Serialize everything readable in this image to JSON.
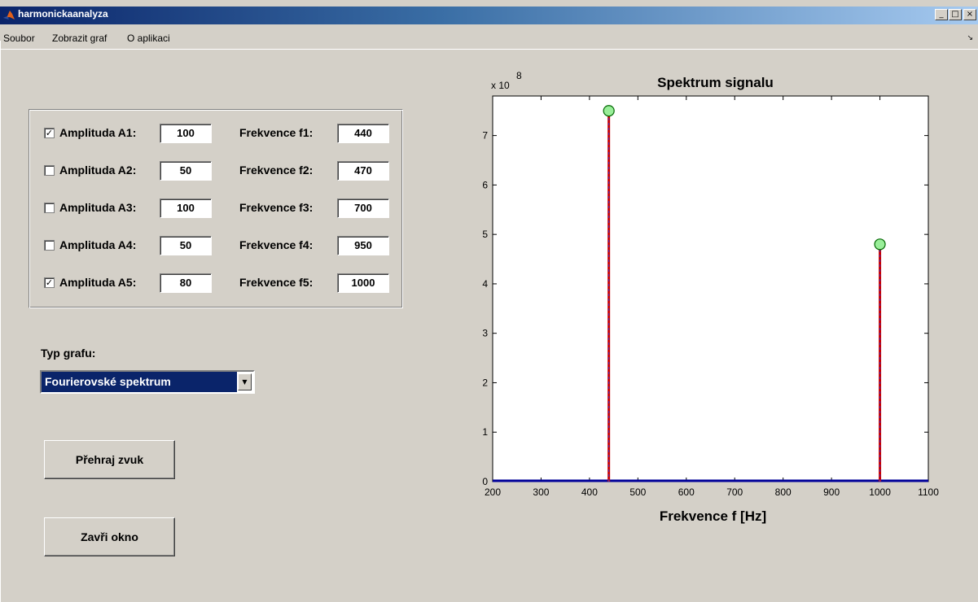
{
  "window": {
    "title": "harmonickaanalyza",
    "buttons": [
      "_",
      "□",
      "×"
    ]
  },
  "menu": {
    "items": [
      "Soubor",
      "Zobrazit graf",
      "O aplikaci"
    ],
    "arrow": "↘"
  },
  "params": {
    "rows": [
      {
        "checked": true,
        "amp_label": "Amplituda A1:",
        "amp": "100",
        "freq_label": "Frekvence f1:",
        "freq": "440"
      },
      {
        "checked": false,
        "amp_label": "Amplituda A2:",
        "amp": "50",
        "freq_label": "Frekvence f2:",
        "freq": "470"
      },
      {
        "checked": false,
        "amp_label": "Amplituda A3:",
        "amp": "100",
        "freq_label": "Frekvence f3:",
        "freq": "700"
      },
      {
        "checked": false,
        "amp_label": "Amplituda A4:",
        "amp": "50",
        "freq_label": "Frekvence f4:",
        "freq": "950"
      },
      {
        "checked": true,
        "amp_label": "Amplituda A5:",
        "amp": "80",
        "freq_label": "Frekvence f5:",
        "freq": "1000"
      }
    ]
  },
  "graph_type": {
    "label": "Typ grafu:",
    "selected": "Fourierovské spektrum"
  },
  "buttons": {
    "play": "Přehraj zvuk",
    "close": "Zavři okno"
  },
  "chart_data": {
    "type": "stem",
    "title": "Spektrum signalu",
    "xlabel": "Frekvence f [Hz]",
    "ylabel": "",
    "scale_label": "x 10",
    "scale_exponent": "8",
    "xlim": [
      200,
      1100
    ],
    "ylim": [
      0,
      7.8
    ],
    "xticks": [
      200,
      300,
      400,
      500,
      600,
      700,
      800,
      900,
      1000,
      1100
    ],
    "yticks": [
      0,
      1,
      2,
      3,
      4,
      5,
      6,
      7
    ],
    "points": [
      {
        "x": 440,
        "y": 7.5
      },
      {
        "x": 1000,
        "y": 4.8
      }
    ],
    "colors": {
      "stem": "#cc0000",
      "stem_dash": "#3333cc",
      "marker_fill": "#99ee99",
      "marker_edge": "#006600",
      "baseline": "#000099"
    }
  }
}
